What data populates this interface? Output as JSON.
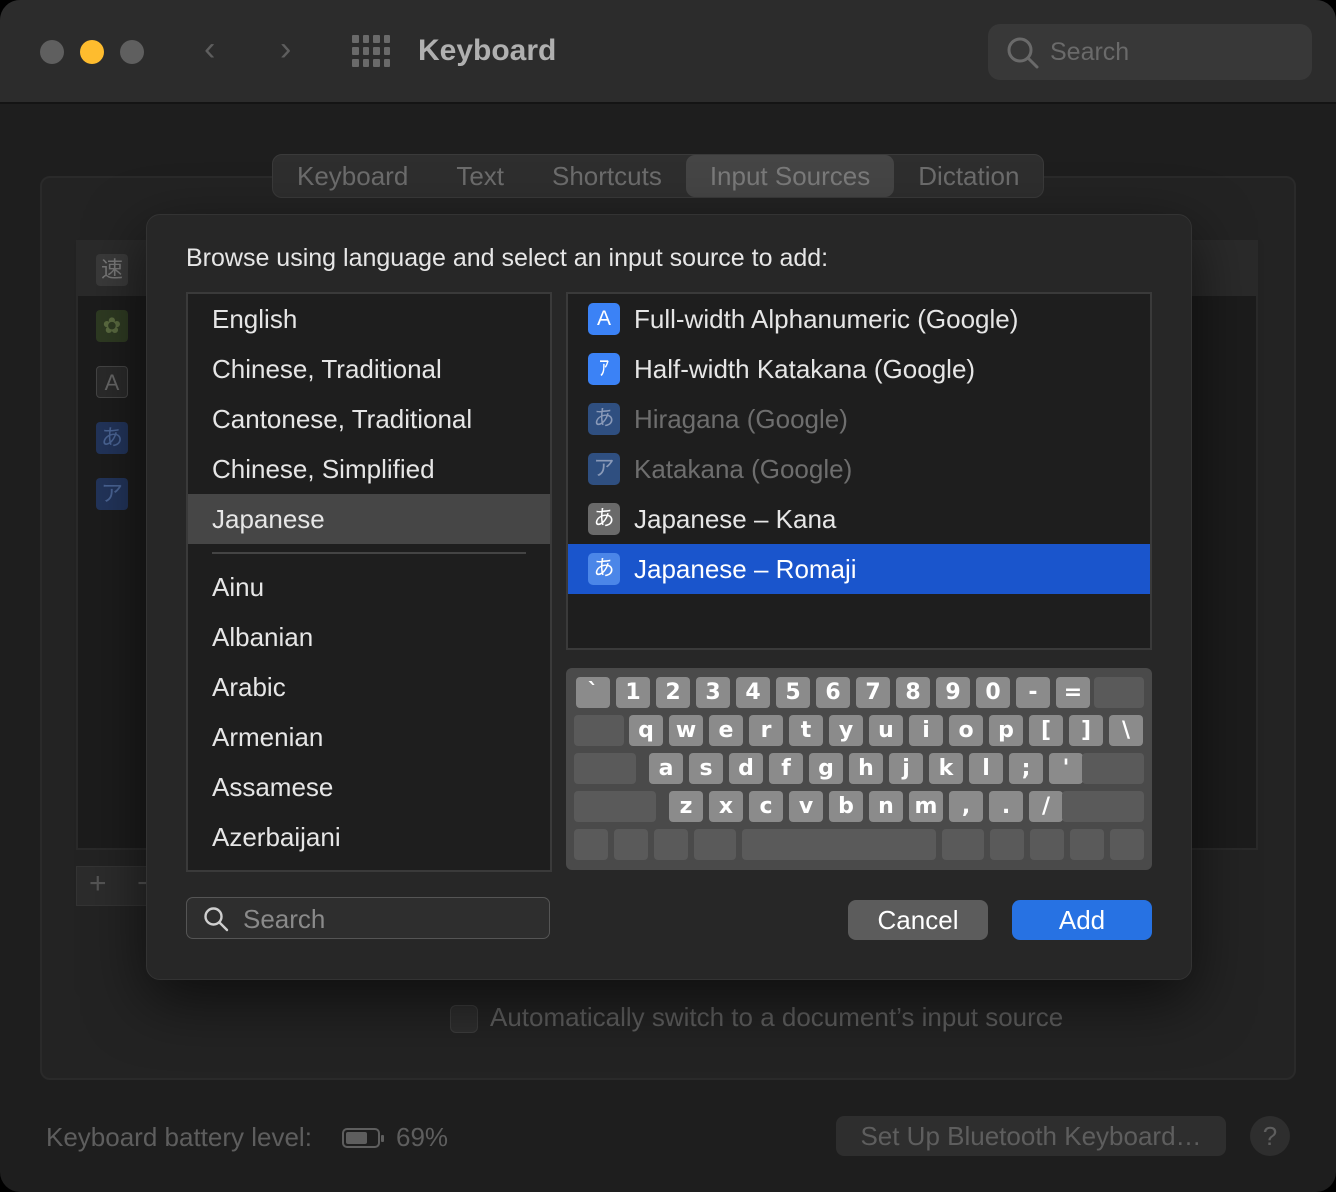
{
  "window": {
    "title": "Keyboard",
    "search_placeholder": "Search"
  },
  "tabs": [
    {
      "label": "Keyboard",
      "active": false
    },
    {
      "label": "Text",
      "active": false
    },
    {
      "label": "Shortcuts",
      "active": false
    },
    {
      "label": "Input Sources",
      "active": true
    },
    {
      "label": "Dictation",
      "active": false
    }
  ],
  "background": {
    "list_icons": [
      "速",
      "",
      "A",
      "あ",
      "ア"
    ],
    "add_remove": [
      "+",
      "−"
    ],
    "auto_switch_label": "Automatically switch to a document’s input source",
    "battery_label": "Keyboard battery level:",
    "battery_level": 0.69,
    "battery_value": "69%",
    "bluetooth_button": "Set Up Bluetooth Keyboard…",
    "help_button": "?"
  },
  "sheet": {
    "prompt": "Browse using language and select an input source to add:",
    "preferred_languages": [
      "English",
      "Chinese, Traditional",
      "Cantonese, Traditional",
      "Chinese, Simplified",
      "Japanese"
    ],
    "selected_language": "Japanese",
    "other_languages": [
      "Ainu",
      "Albanian",
      "Arabic",
      "Armenian",
      "Assamese",
      "Azerbaijani"
    ],
    "sources": [
      {
        "label": "Full-width Alphanumeric (Google)",
        "icon": "A",
        "icon_color": "#3b82f6",
        "enabled": true,
        "selected": false
      },
      {
        "label": "Half-width Katakana (Google)",
        "icon": "ｱ",
        "icon_color": "#3b82f6",
        "enabled": true,
        "selected": false
      },
      {
        "label": "Hiragana (Google)",
        "icon": "あ",
        "icon_color": "#2f4f80",
        "enabled": false,
        "selected": false
      },
      {
        "label": "Katakana (Google)",
        "icon": "ア",
        "icon_color": "#2f4f80",
        "enabled": false,
        "selected": false
      },
      {
        "label": "Japanese – Kana",
        "icon": "あ",
        "icon_color": "#6a6a6a",
        "enabled": true,
        "selected": false
      },
      {
        "label": "Japanese – Romaji",
        "icon": "あ",
        "icon_color": "#4b86e8",
        "enabled": true,
        "selected": true
      }
    ],
    "keyboard_rows": [
      [
        "`",
        "1",
        "2",
        "3",
        "4",
        "5",
        "6",
        "7",
        "8",
        "9",
        "0",
        "-",
        "="
      ],
      [
        "q",
        "w",
        "e",
        "r",
        "t",
        "y",
        "u",
        "i",
        "o",
        "p",
        "[",
        "]",
        "\\"
      ],
      [
        "a",
        "s",
        "d",
        "f",
        "g",
        "h",
        "j",
        "k",
        "l",
        ";",
        "'"
      ],
      [
        "z",
        "x",
        "c",
        "v",
        "b",
        "n",
        "m",
        ",",
        ".",
        "/"
      ]
    ],
    "search_placeholder": "Search",
    "cancel_label": "Cancel",
    "add_label": "Add"
  },
  "colors": {
    "accent": "#2772e3",
    "selection": "#1a55cc",
    "close": "#5f5f5f",
    "minimize": "#febc2e",
    "zoom": "#5f5f5f"
  }
}
